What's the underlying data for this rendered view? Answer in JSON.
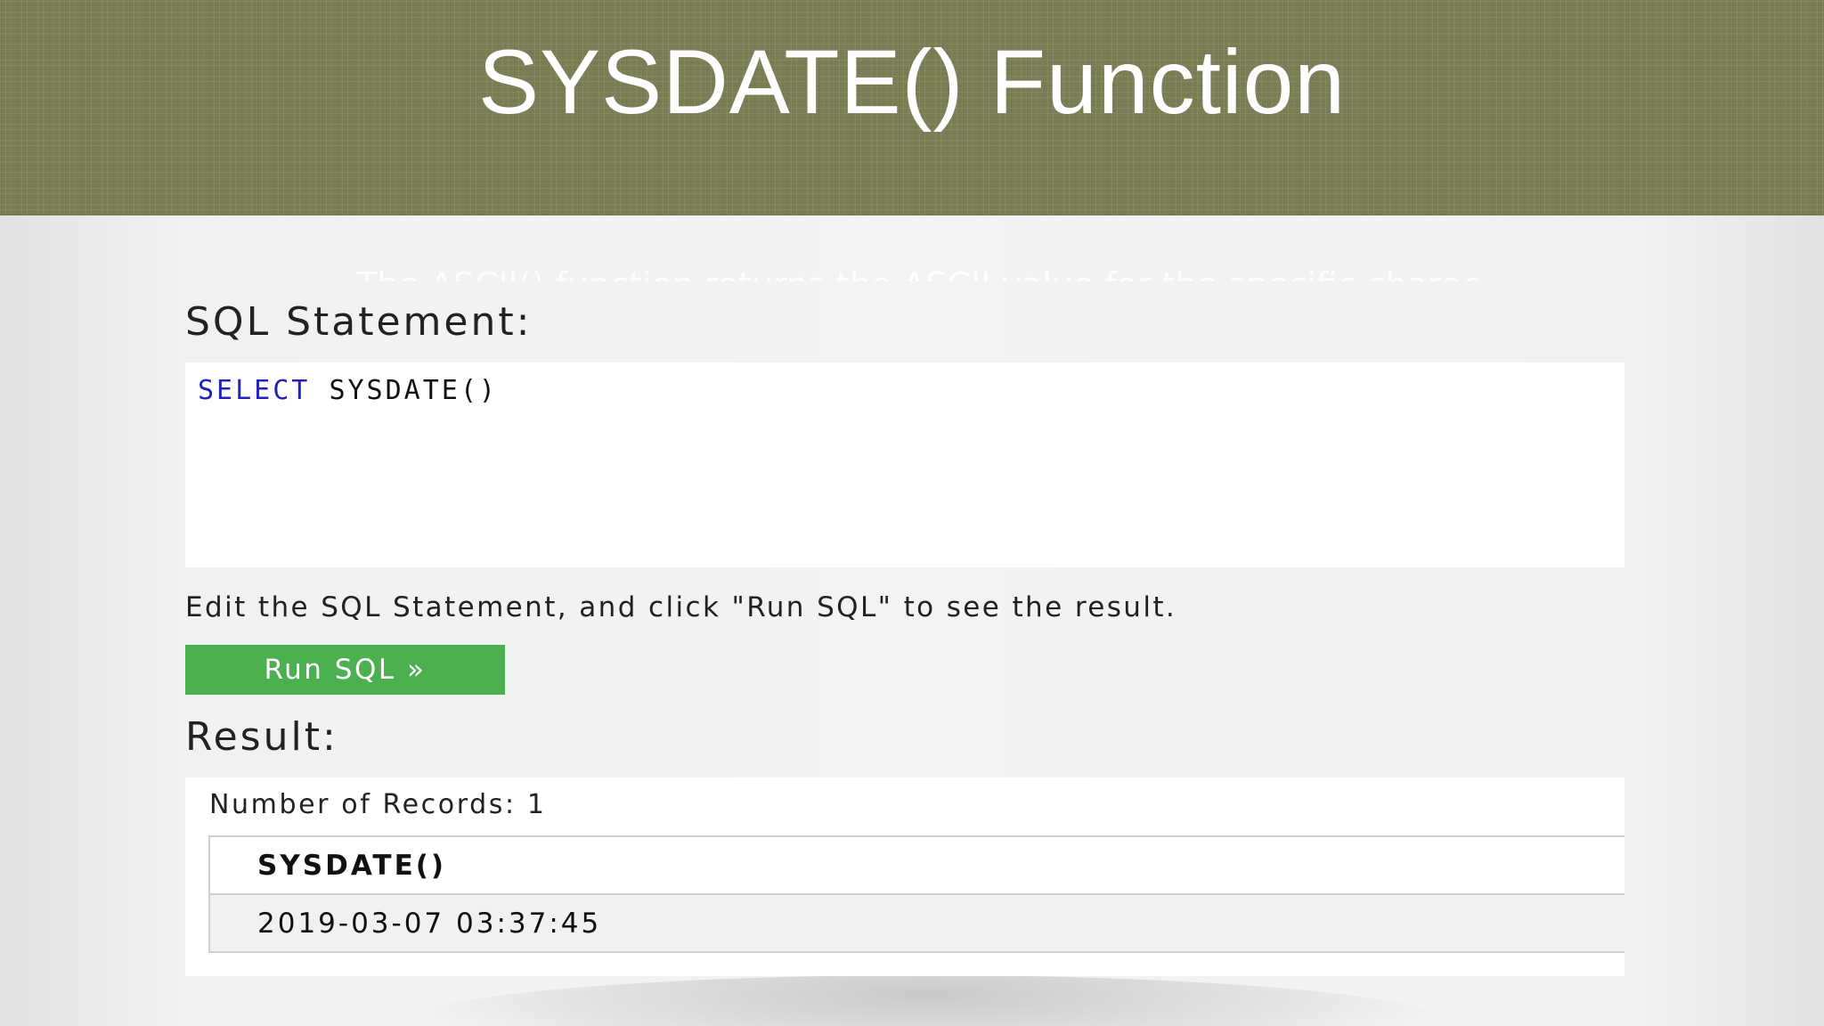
{
  "slide": {
    "title": "SYSDATE() Function",
    "ghost_text": "The ASCII() function returns the ASCII value for the specific character."
  },
  "sql_section": {
    "heading": "SQL Statement:",
    "code_keyword": "SELECT",
    "code_rest": "SYSDATE()",
    "keyword_color": "#2222bb"
  },
  "instructions": "Edit the SQL Statement, and click \"Run SQL\" to see the result.",
  "run_button": {
    "label": "Run SQL »",
    "color": "#4caf50"
  },
  "result_section": {
    "heading": "Result:",
    "records_label": "Number of Records: 1",
    "columns": [
      "SYSDATE()"
    ],
    "rows": [
      [
        "2019-03-07 03:37:45"
      ]
    ]
  },
  "colors": {
    "banner": "#7a7d52",
    "background": "#f2f2f3"
  }
}
